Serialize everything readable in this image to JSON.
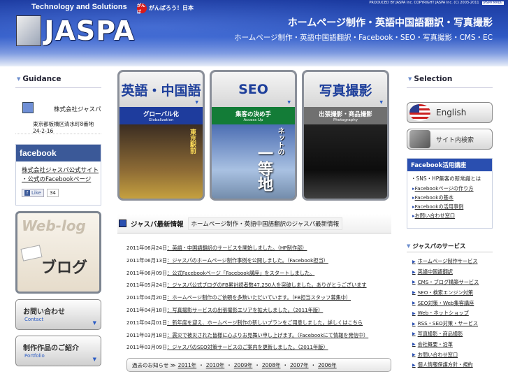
{
  "header": {
    "tagline": "Technology and Solutions",
    "ganbaro_mark": "がんば",
    "ganbaro_text": "がんばろう！日本",
    "copyright": "PRODUCED BY JASPA Inc.  COPYRIGHT JASPA Inc. (C) 2003-2011",
    "copyright_badge": "JASPA MADE",
    "logo_text": "JASPA",
    "title": "ホームページ制作・英語中国語翻訳・写真撮影",
    "subtitle": "ホームページ制作・英語中国語翻訳・Facebook・SEO・写真撮影・CMS・EC"
  },
  "left": {
    "guidance_heading": "Guidance",
    "guidance_name": "株式会社ジャスパ",
    "guidance_address": "東京都板橋区清水町8番地24-2-16",
    "facebook_heading": "facebook",
    "facebook_link1": "株式会社ジャスパ公式サイト",
    "facebook_link2": "・公式のFacebookページ",
    "like_label": "Like",
    "like_count": "34",
    "blog_web": "Web-log",
    "blog_label": "ブログ",
    "contact_jp": "お問い合わせ",
    "contact_en": "Contact",
    "portfolio_jp": "制作作品のご紹介",
    "portfolio_en": "Portfolio",
    "dropdown_arrow": "▼"
  },
  "banners": [
    {
      "cap": "英語・中国語",
      "bar_jp": "グローバル化",
      "bar_en": "Globalization",
      "sign": "東京駅前"
    },
    {
      "cap": "SEO",
      "bar_jp": "集客の決め手",
      "bar_en": "Access Up",
      "small": "ネットの",
      "kanji": "一等地"
    },
    {
      "cap": "写真撮影",
      "bar_jp": "出張撮影・商品撮影",
      "bar_en": "Photography"
    }
  ],
  "news": {
    "title": "ジャスパ最新情報",
    "subtitle": "ホームページ制作・英語中国語翻訳のジャスパ最新情報",
    "items": [
      {
        "date": "2011年06月24日",
        "text": "：英語・中国語翻訳のサービスを開始しました。（HP制作部）"
      },
      {
        "date": "2011年06月13日",
        "text": "：ジャスパのホームページ制作事例を公開しました。（Facebook担当）"
      },
      {
        "date": "2011年06月09日",
        "text": "：公式Facebookページ「Facebook講座」をスタートしました。"
      },
      {
        "date": "2011年05月24日",
        "text": "：ジャスパ公式ブログのFB累計読者数47,250人を突破しました。ありがとうございます"
      },
      {
        "date": "2011年04月20日",
        "text": "：ホームページ制作のご依頼を多数いただいています。（FB担当スタッフ募集中）"
      },
      {
        "date": "2011年04月18日",
        "text": "：写真撮影サービスの出張撮影エリアを拡大しました。（2011年版）"
      },
      {
        "date": "2011年04月01日",
        "text": "：新年度を迎え、ホームページ制作の新しいプランをご用意しました。詳しくはこちら"
      },
      {
        "date": "2011年03月18日",
        "text": "：震災で被災された皆様に心よりお見舞い申し上げます。（Facebookにて情報を発信中）"
      },
      {
        "date": "2011年03月09日",
        "text": "：ジャスパのSEO対策サービスのご案内を更新しました。（2011年版）"
      }
    ],
    "archive_label": "過去のお知らせ ≫",
    "archive_years": [
      "2011年",
      "2010年",
      "2009年",
      "2008年",
      "2007年",
      "2006年"
    ]
  },
  "right": {
    "selection_heading": "Selection",
    "english_label": "English",
    "search_label": "サイト内検索",
    "fb_heading": "Facebook活用講座",
    "fb_intro": "・SNS・HP集客の新常識とは",
    "fb_items": [
      "Facebookページの作り方",
      "Facebookの基本",
      "Facebookの活用事例",
      "お問い合わせ窓口"
    ],
    "service_heading": "ジャスパのサービス",
    "services": [
      "ホームページ制作サービス",
      "英語中国語翻訳",
      "CMS・ブログ構築サービス",
      "SEO・検索エンジン対策",
      "SEO対策・Web集客講座",
      "Web・ネットショップ",
      "RSS・SEO対策・サービス",
      "写真撮影・商品撮影",
      "会社概要・沿革",
      "お問い合わせ窓口",
      "個人情報保護方針・規約"
    ]
  }
}
